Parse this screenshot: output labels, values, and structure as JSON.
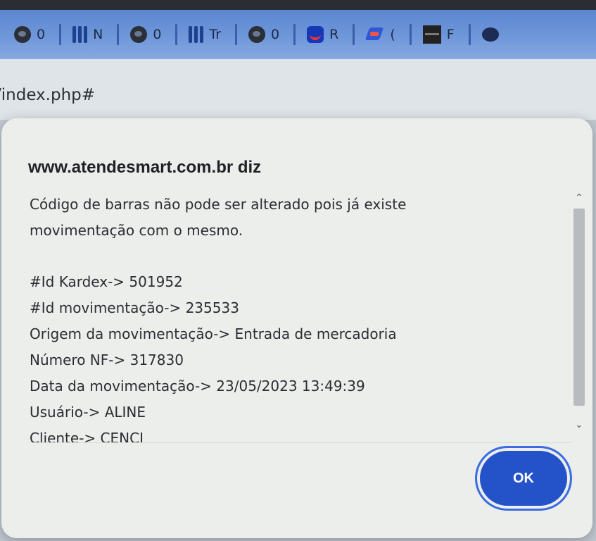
{
  "bookmarks": [
    {
      "icon": "circle-logo-icon",
      "label": "0"
    },
    {
      "icon": "bars-logo-icon",
      "label": "N"
    },
    {
      "icon": "circle-logo-icon",
      "label": "0"
    },
    {
      "icon": "bars-logo-icon",
      "label": "Tr"
    },
    {
      "icon": "circle-logo-icon",
      "label": "0"
    },
    {
      "icon": "shield-logo-icon",
      "label": "R"
    },
    {
      "icon": "flag-logo-icon",
      "label": "("
    },
    {
      "icon": "black-box-logo-icon",
      "label": "F"
    }
  ],
  "address_bar": {
    "url_fragment": "/index.php#"
  },
  "dialog": {
    "title": "www.atendesmart.com.br diz",
    "message_lines": [
      "Código de barras não pode ser alterado pois já existe",
      "movimentação com o mesmo."
    ],
    "details": [
      "#Id Kardex-> 501952",
      "#Id movimentação-> 235533",
      "Origem da movimentação-> Entrada de mercadoria",
      "Número NF-> 317830",
      "Data da movimentação-> 23/05/2023 13:49:39",
      "Usuário-> ALINE",
      "Cliente-> CENCI"
    ],
    "ok_label": "OK"
  },
  "colors": {
    "ok_button": "#2453c9",
    "bookmarks_bar": "#6f97da"
  }
}
